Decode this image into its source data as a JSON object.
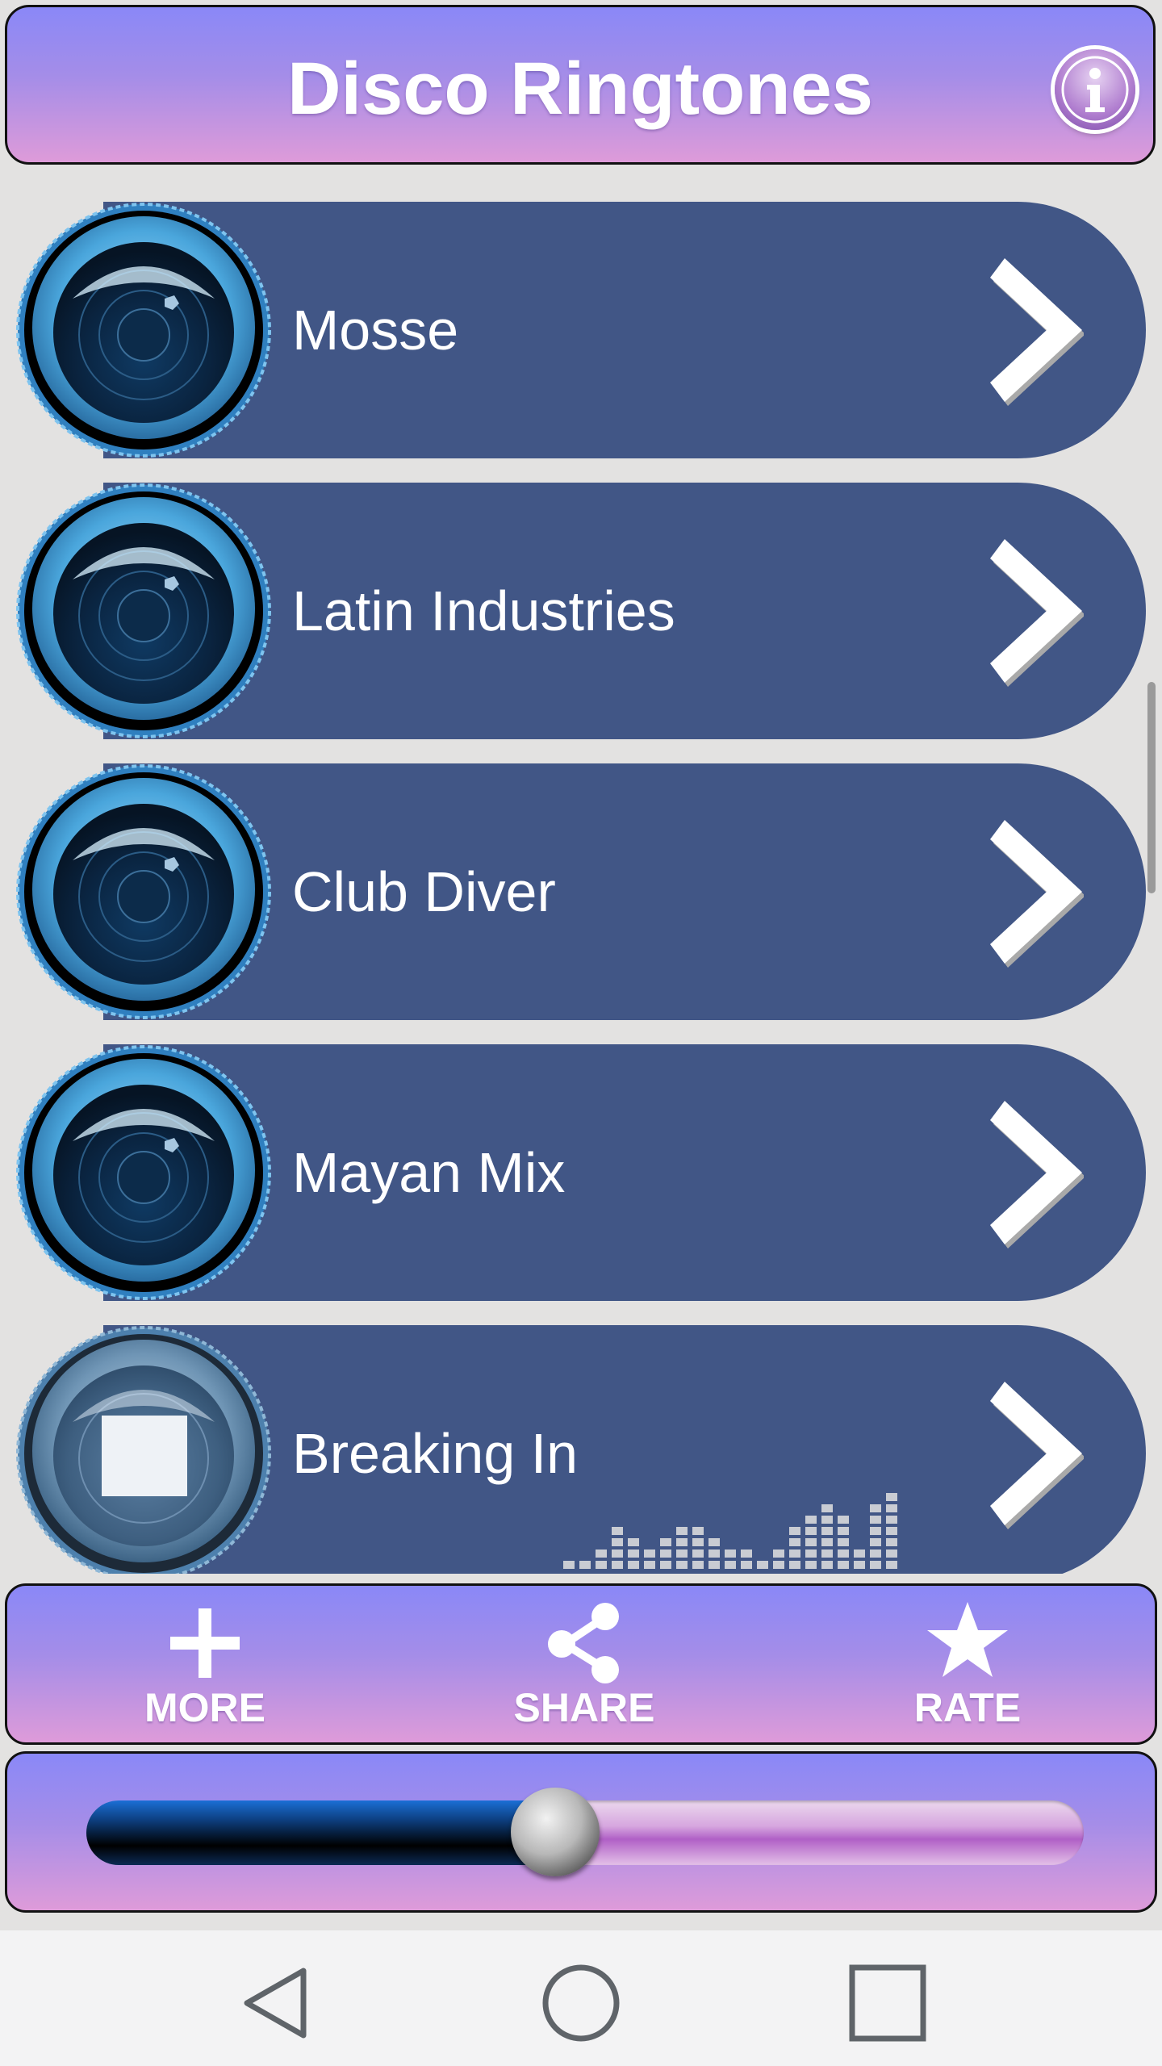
{
  "app": {
    "title": "Disco Ringtones"
  },
  "header": {
    "info_icon": "info-icon"
  },
  "ringtones": [
    {
      "label": "Mosse",
      "state": "idle"
    },
    {
      "label": "Latin Industries",
      "state": "idle"
    },
    {
      "label": "Club Diver",
      "state": "idle"
    },
    {
      "label": "Mayan Mix",
      "state": "idle"
    },
    {
      "label": "Breaking In",
      "state": "playing"
    }
  ],
  "toolbar": {
    "more_label": "MORE",
    "share_label": "SHARE",
    "rate_label": "RATE"
  },
  "player": {
    "progress": 0.47
  },
  "colors": {
    "pill": "#415686",
    "header_top": "#8a88f7",
    "header_bottom": "#de9bd9",
    "background": "#e3e2e1"
  },
  "system_nav": [
    "back-icon",
    "home-icon",
    "recents-icon"
  ]
}
